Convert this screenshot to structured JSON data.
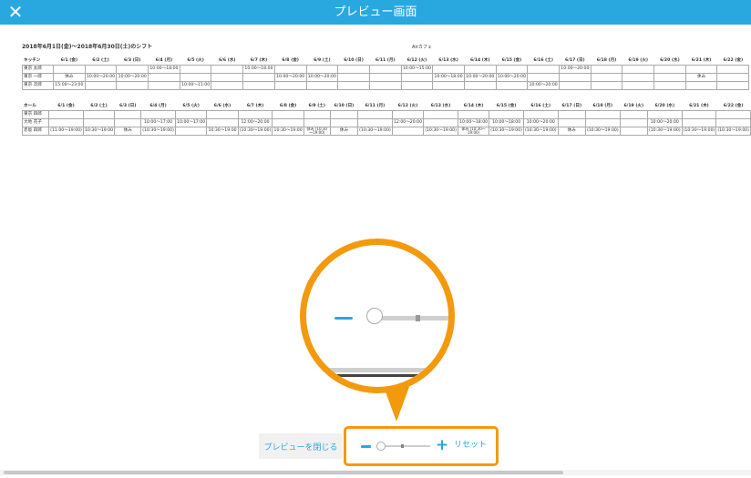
{
  "header": {
    "title": "プレビュー画面",
    "close_icon": "close-icon",
    "color": "#29a8e0"
  },
  "sheet": {
    "period": "2018年6月1日(金)～2018年6月30日(土)のシフト",
    "store": "Airカフェ",
    "kitchen": {
      "section": "キッチン",
      "dates": [
        "6/1 (金)",
        "6/2 (土)",
        "6/3 (日)",
        "6/4 (月)",
        "6/5 (火)",
        "6/6 (水)",
        "6/7 (木)",
        "6/8 (金)",
        "6/9 (土)",
        "6/10 (日)",
        "6/11 (月)",
        "6/12 (火)",
        "6/13 (水)",
        "6/14 (木)",
        "6/15 (金)",
        "6/16 (土)",
        "6/17 (日)",
        "6/18 (月)",
        "6/19 (火)",
        "6/20 (水)",
        "6/21 (木)",
        "6/22 (金)"
      ],
      "rows": [
        {
          "name": "東京 太郎",
          "cells": [
            "",
            "",
            "",
            "10:00～18:00",
            "",
            "",
            "10:00～18:00",
            "",
            "",
            "",
            "",
            "10:00～15:00",
            "",
            "",
            "",
            "",
            "10:00～20:00",
            "",
            "",
            "",
            "",
            ""
          ]
        },
        {
          "name": "東京 一郎",
          "cells": [
            "休み",
            "10:00～20:00",
            "10:00～20:00",
            "",
            "",
            "",
            "",
            "10:00～20:00",
            "10:00～20:00",
            "",
            "",
            "",
            "10:00～18:00",
            "10:00～20:00",
            "10:00～20:00",
            "",
            "",
            "",
            "",
            "",
            "休み",
            ""
          ]
        },
        {
          "name": "東京 次郎",
          "cells": [
            "15:00～23:00",
            "",
            "",
            "",
            "10:00～11:00",
            "",
            "",
            "",
            "",
            "",
            "",
            "",
            "",
            "",
            "",
            "10:00～20:00",
            "",
            "",
            "",
            "",
            "",
            ""
          ]
        }
      ]
    },
    "hall": {
      "section": "ホール",
      "dates": [
        "6/1 (金)",
        "6/2 (土)",
        "6/3 (日)",
        "6/4 (月)",
        "6/5 (火)",
        "6/6 (水)",
        "6/7 (木)",
        "6/8 (金)",
        "6/9 (土)",
        "6/10 (日)",
        "6/11 (月)",
        "6/12 (火)",
        "6/13 (水)",
        "6/14 (木)",
        "6/15 (金)",
        "6/16 (土)",
        "6/17 (日)",
        "6/18 (月)",
        "6/19 (火)",
        "6/20 (水)",
        "6/21 (木)",
        "6/22 (金)"
      ],
      "rows": [
        {
          "name": "東京 四郎",
          "cells": [
            "",
            "",
            "",
            "",
            "",
            "",
            "",
            "",
            "",
            "",
            "",
            "",
            "",
            "",
            "",
            "",
            "",
            "",
            "",
            "",
            "",
            ""
          ]
        },
        {
          "name": "大地 花子",
          "cells": [
            "",
            "",
            "",
            "10:00～17:00",
            "10:00～17:00",
            "",
            "12:00～20:00",
            "",
            "",
            "",
            "",
            "12:00～20:00",
            "",
            "10:00～18:00",
            "10:00～18:00",
            "10:00～20:00",
            "",
            "",
            "",
            "10:00～20:00",
            "",
            ""
          ]
        },
        {
          "name": "赤坂 四郎",
          "cells": [
            "(11:00～19:00)",
            "10:30～19:00",
            "休み",
            "(10:30～19:00)",
            "",
            "10:30～19:00",
            "(10:30～19:00)",
            "10:30～19:00",
            "休み (10:30～19:00)",
            "休み",
            "(10:30～19:00)",
            "",
            "(10:30～19:00)",
            "休み (10:30～19:00)",
            "(10:30～19:00)",
            "(10:30～19:00)",
            "休み",
            "(10:30～19:00)",
            "",
            "(10:30～19:00)",
            "(10:30～19:00)",
            "(10:30～19:00)"
          ]
        }
      ]
    }
  },
  "footer": {
    "close_preview_label": "プレビューを閉じる",
    "zoom_minus_icon": "minus-icon",
    "zoom_plus_label": "+",
    "reset_label": "リセット",
    "zoom_level_fraction": 0.0,
    "highlight_color": "#f39a0c"
  }
}
